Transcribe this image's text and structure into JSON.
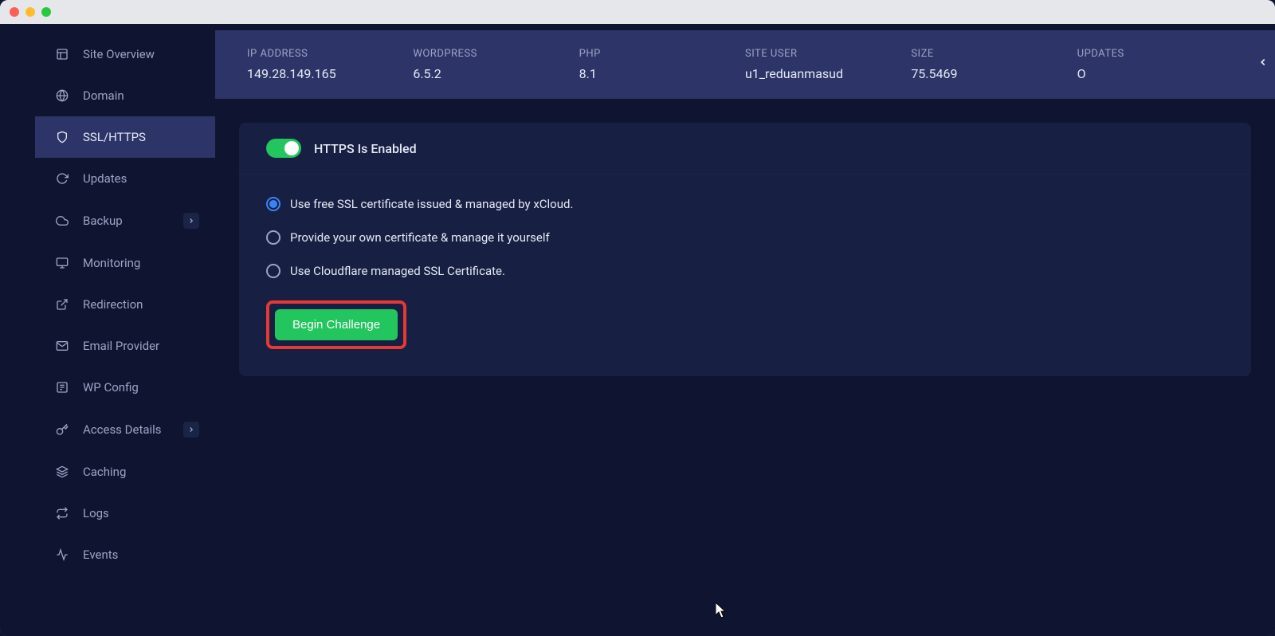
{
  "sidebar": {
    "items": [
      {
        "label": "Site Overview",
        "icon": "overview"
      },
      {
        "label": "Domain",
        "icon": "domain"
      },
      {
        "label": "SSL/HTTPS",
        "icon": "shield",
        "active": true
      },
      {
        "label": "Updates",
        "icon": "refresh"
      },
      {
        "label": "Backup",
        "icon": "cloud",
        "chevron": true
      },
      {
        "label": "Monitoring",
        "icon": "monitor"
      },
      {
        "label": "Redirection",
        "icon": "external"
      },
      {
        "label": "Email Provider",
        "icon": "mail"
      },
      {
        "label": "WP Config",
        "icon": "config"
      },
      {
        "label": "Access Details",
        "icon": "key",
        "chevron": true
      },
      {
        "label": "Caching",
        "icon": "layers"
      },
      {
        "label": "Logs",
        "icon": "swap"
      },
      {
        "label": "Events",
        "icon": "activity"
      }
    ]
  },
  "info_bar": {
    "ip_address": {
      "label": "IP ADDRESS",
      "value": "149.28.149.165"
    },
    "wordpress": {
      "label": "WORDPRESS",
      "value": "6.5.2"
    },
    "php": {
      "label": "PHP",
      "value": "8.1"
    },
    "site_user": {
      "label": "SITE USER",
      "value": "u1_reduanmasud"
    },
    "size": {
      "label": "SIZE",
      "value": "75.5469"
    },
    "updates": {
      "label": "UPDATES",
      "value": "O"
    }
  },
  "ssl_panel": {
    "toggle_label": "HTTPS Is Enabled",
    "toggle_enabled": true,
    "radio_options": [
      {
        "label": "Use free SSL certificate issued & managed by xCloud.",
        "selected": true
      },
      {
        "label": "Provide your own certificate & manage it yourself",
        "selected": false
      },
      {
        "label": "Use Cloudflare managed SSL Certificate.",
        "selected": false
      }
    ],
    "begin_button": "Begin Challenge"
  },
  "colors": {
    "accent_green": "#22c55e",
    "accent_blue": "#3b82f6",
    "highlight_red": "#e53935",
    "bg_dark": "#0f1530",
    "bg_panel": "#171f42",
    "bg_active": "#2d3568"
  }
}
